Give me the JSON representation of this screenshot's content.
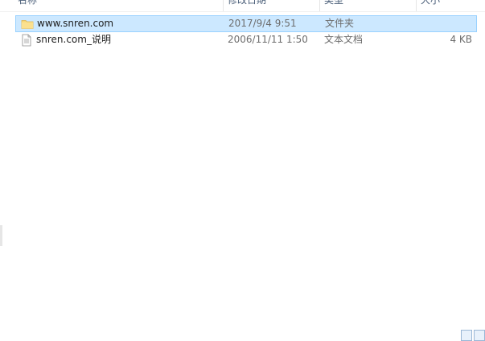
{
  "columns": {
    "name": "名称",
    "date": "修改日期",
    "type": "类型",
    "size": "大小"
  },
  "files": [
    {
      "name": "www.snren.com",
      "date": "2017/9/4 9:51",
      "type": "文件夹",
      "size": "",
      "icon": "folder-icon",
      "selected": true
    },
    {
      "name": "snren.com_说明",
      "date": "2006/11/11 1:50",
      "type": "文本文档",
      "size": "4 KB",
      "icon": "text-file-icon",
      "selected": false
    }
  ],
  "colors": {
    "selection_bg": "#cce8ff",
    "selection_border": "#99d1ff",
    "folder": "#f8d775",
    "header_text": "#4c607a"
  }
}
